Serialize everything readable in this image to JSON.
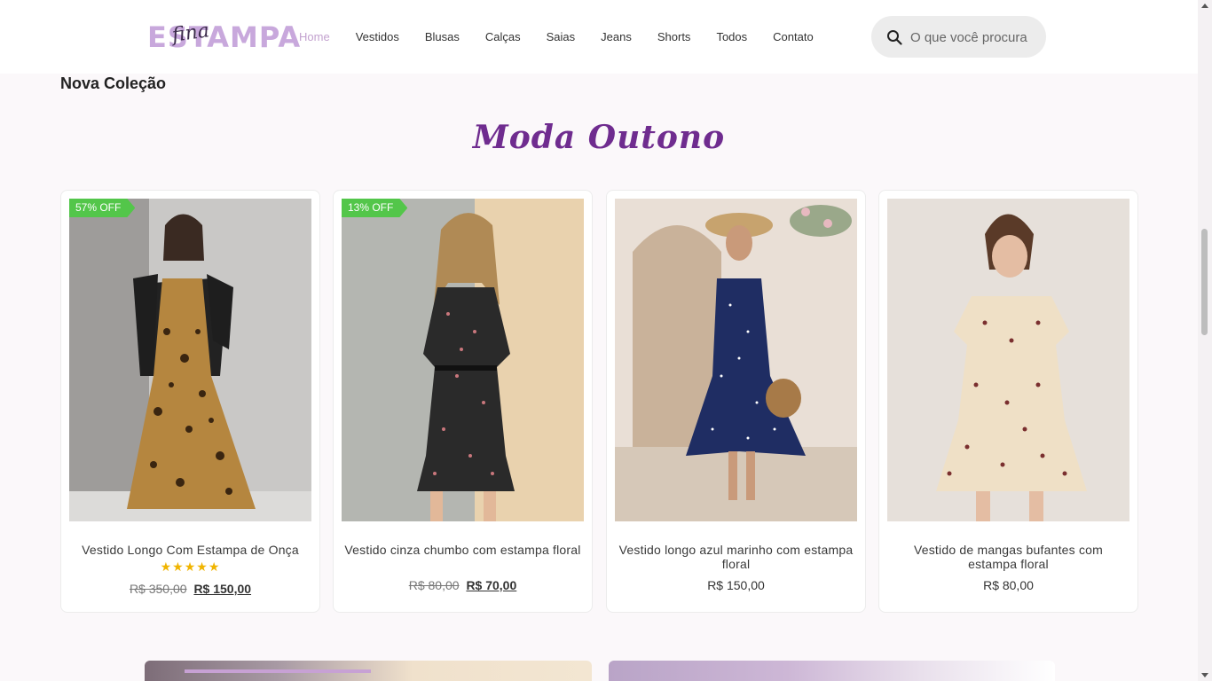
{
  "brand": {
    "logo_main": "ESTAMPA",
    "logo_script": "fina"
  },
  "nav": [
    {
      "label": "Home",
      "active": true
    },
    {
      "label": "Vestidos"
    },
    {
      "label": "Blusas"
    },
    {
      "label": "Calças"
    },
    {
      "label": "Saias"
    },
    {
      "label": "Jeans"
    },
    {
      "label": "Shorts"
    },
    {
      "label": "Todos"
    },
    {
      "label": "Contato"
    }
  ],
  "search": {
    "placeholder": "O que você procura",
    "icon": "search-icon"
  },
  "section": {
    "title": "Nova Coleção",
    "collection": "Moda Outono"
  },
  "products": [
    {
      "badge": "57% OFF",
      "name": "Vestido Longo Com Estampa de Onça",
      "rating": 5,
      "stars": "★★★★★",
      "old_price": "R$ 350,00",
      "price": "R$ 150,00"
    },
    {
      "badge": "13% OFF",
      "name": "Vestido cinza chumbo com estampa floral",
      "old_price": "R$ 80,00",
      "price": "R$ 70,00"
    },
    {
      "name": "Vestido longo azul marinho com estampa floral",
      "price": "R$ 150,00"
    },
    {
      "name": "Vestido de mangas bufantes com estampa floral",
      "price": "R$ 80,00"
    }
  ],
  "colors": {
    "accent": "#6f2c8f",
    "nav_active": "#c3a2cf",
    "badge": "#53c64a",
    "stars": "#f0b400"
  }
}
